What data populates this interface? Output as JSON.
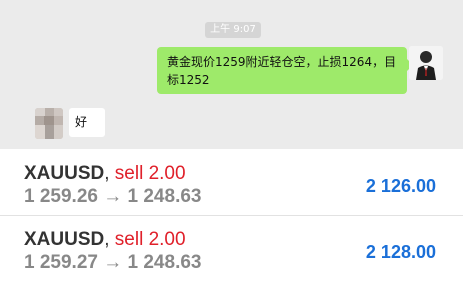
{
  "chat": {
    "timestamp": "上午 9:07",
    "sent_message": "黄金现价1259附近轻仓空，止损1264，目标1252",
    "received_message": "好"
  },
  "trades": [
    {
      "symbol": "XAUUSD",
      "separator": ",",
      "action": "sell 2.00",
      "prices": "1 259.26 → 1 248.63",
      "profit": "2 126.00"
    },
    {
      "symbol": "XAUUSD",
      "separator": ",",
      "action": "sell 2.00",
      "prices": "1 259.27 → 1 248.63",
      "profit": "2 128.00"
    }
  ],
  "colors": {
    "chat_background": "#ebebeb",
    "sent_bubble": "#9eea6a",
    "sell_action": "#e0202a",
    "profit": "#1a6fd8",
    "price_gray": "#888888"
  }
}
